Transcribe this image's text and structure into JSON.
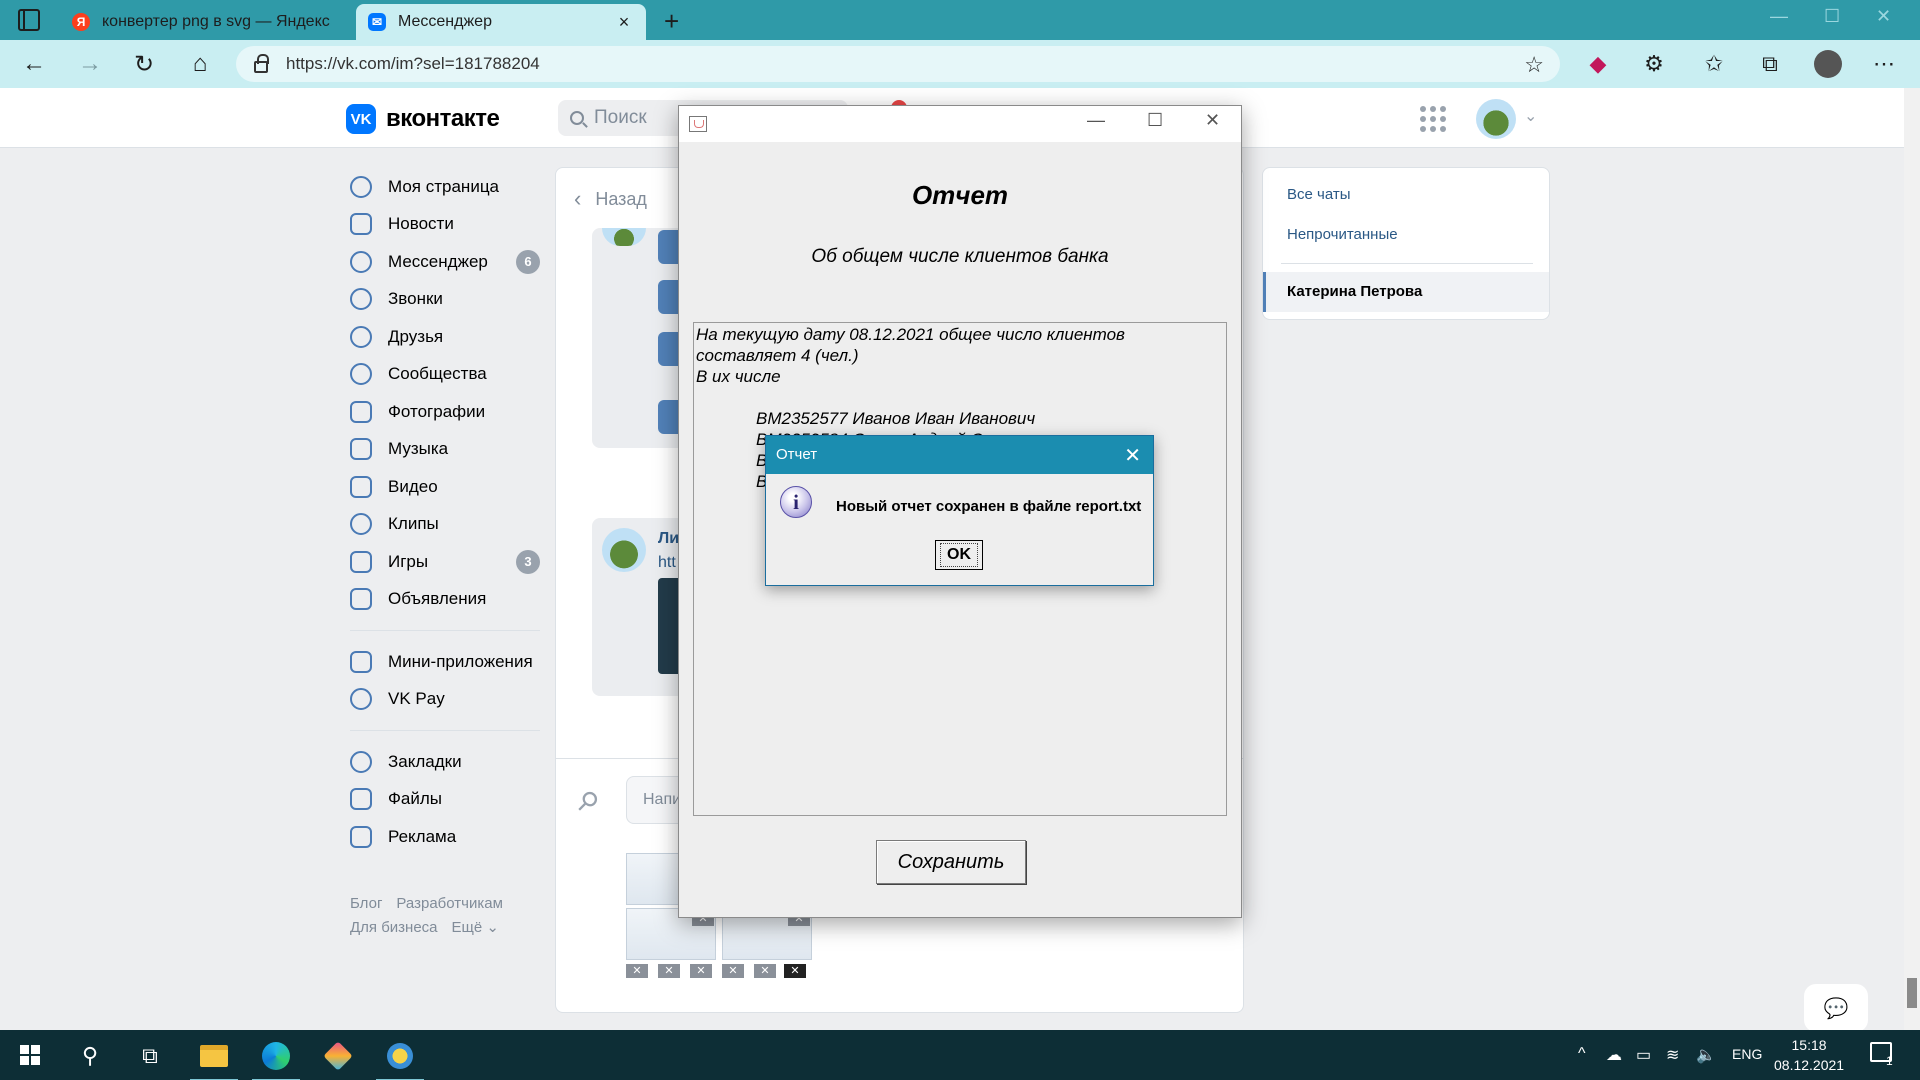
{
  "browser": {
    "tabs": [
      {
        "title": "конвертер png в svg — Яндекс",
        "favicon": "yandex-icon",
        "active": false
      },
      {
        "title": "Мессенджер",
        "favicon": "vk-icon",
        "active": true
      }
    ],
    "new_tab": "+",
    "close": "×",
    "url": "https://vk.com/im?sel=181788204"
  },
  "vk": {
    "logo_mark": "VK",
    "logo_text": "вконтакте",
    "search_placeholder": "Поиск",
    "nav": [
      {
        "label": "Моя страница",
        "icon": "user-circle-icon"
      },
      {
        "label": "Новости",
        "icon": "news-icon"
      },
      {
        "label": "Мессенджер",
        "icon": "message-icon",
        "badge": "6"
      },
      {
        "label": "Звонки",
        "icon": "phone-icon"
      },
      {
        "label": "Друзья",
        "icon": "friends-icon"
      },
      {
        "label": "Сообщества",
        "icon": "community-icon"
      },
      {
        "label": "Фотографии",
        "icon": "photo-icon"
      },
      {
        "label": "Музыка",
        "icon": "music-icon"
      },
      {
        "label": "Видео",
        "icon": "video-icon"
      },
      {
        "label": "Клипы",
        "icon": "clips-icon"
      },
      {
        "label": "Игры",
        "icon": "gamepad-icon",
        "badge": "3"
      },
      {
        "label": "Объявления",
        "icon": "ads-icon"
      }
    ],
    "nav2": [
      {
        "label": "Мини-приложения",
        "icon": "apps-icon"
      },
      {
        "label": "VK Pay",
        "icon": "vkpay-icon"
      }
    ],
    "nav3": [
      {
        "label": "Закладки",
        "icon": "star-icon"
      },
      {
        "label": "Файлы",
        "icon": "file-icon"
      },
      {
        "label": "Реклама",
        "icon": "megaphone-icon"
      }
    ],
    "footer": [
      "Блог",
      "Разработчикам",
      "Для бизнеса",
      "Ещё ⌄"
    ],
    "back_label": "Назад",
    "snippet_name": "Ли",
    "snippet_link": "htt",
    "composer_placeholder": "Напи",
    "right_panel": {
      "all_chats": "Все чаты",
      "unread": "Непрочитанные",
      "active_chat": "Катерина Петрова"
    }
  },
  "report_window": {
    "heading": "Отчет",
    "subheading": "Об общем числе клиентов банка",
    "text_lines": [
      "На текущую дату 08.12.2021 общее число клиентов",
      "составляет 4 (чел.)",
      "В их числе"
    ],
    "clients": [
      "ВМ2352577 Иванов Иван Иванович",
      "ВМ2352584 Орлов Андрей С",
      "В",
      "В"
    ],
    "save_button": "Сохранить"
  },
  "dialog": {
    "title": "Отчет",
    "message": "Новый отчет сохранен в файле report.txt",
    "ok": "OK"
  },
  "taskbar": {
    "lang": "ENG",
    "time": "15:18",
    "date": "08.12.2021",
    "notif_count": "1"
  },
  "colors": {
    "browser_accent": "#2f9aa8",
    "vk_blue": "#0077ff",
    "dialog_title": "#1b8db0",
    "taskbar": "#0d2e36"
  }
}
